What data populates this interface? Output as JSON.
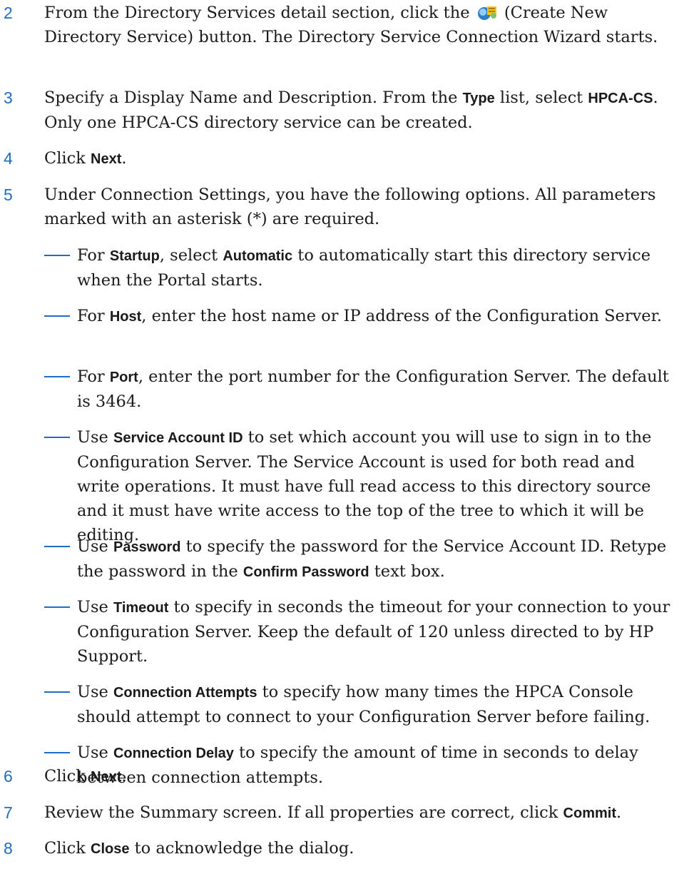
{
  "steps": {
    "s2": {
      "num": "2",
      "a": "From the Directory Services detail section, click the ",
      "icon_name": "create-directory-service-icon",
      "b": " (Create New Directory Service) button. The Directory Service Connection Wizard starts."
    },
    "s3": {
      "num": "3",
      "a": "Specify a Display Name and Description. From the ",
      "k1": "Type",
      "b": " list, select ",
      "k2": "HPCA-CS",
      "c": ". Only one HPCA-CS directory service can be created."
    },
    "s4": {
      "num": "4",
      "a": "Click ",
      "k1": "Next",
      "b": "."
    },
    "s5": {
      "num": "5",
      "a": "Under Connection Settings, you have the following options. All parameters marked with an asterisk (*) are required."
    },
    "s6": {
      "num": "6",
      "a": "Click ",
      "k1": "Next",
      "b": "."
    },
    "s7": {
      "num": "7",
      "a": "Review the Summary screen. If all properties are correct, click ",
      "k1": "Commit",
      "b": "."
    },
    "s8": {
      "num": "8",
      "a": "Click ",
      "k1": "Close",
      "b": " to acknowledge the dialog."
    }
  },
  "options": {
    "startup": {
      "a": "For ",
      "k1": "Startup",
      "b": ", select ",
      "k2": "Automatic",
      "c": " to automatically start this directory service when the Portal starts."
    },
    "host": {
      "a": "For ",
      "k1": "Host",
      "b": ", enter the host name or IP address of the Configuration Server."
    },
    "port": {
      "a": "For ",
      "k1": "Port",
      "b": ", enter the port number for the Configuration Server. The default is 3464."
    },
    "service_account": {
      "a": "Use ",
      "k1": "Service Account ID",
      "b": " to set which account you will use to sign in to the Configuration Server. The Service Account is used for both read and write operations. It must have full read access to this directory source and it must have write access to the top of the tree to which it will be editing."
    },
    "password": {
      "a": "Use ",
      "k1": "Password",
      "b": " to specify the password for the Service Account ID. Retype the password in the ",
      "k2": "Confirm Password",
      "c": " text box."
    },
    "timeout": {
      "a": "Use ",
      "k1": "Timeout",
      "b": " to specify in seconds the timeout for your connection to your Configuration Server. Keep the default of 120 unless directed to by HP Support."
    },
    "attempts": {
      "a": "Use ",
      "k1": "Connection Attempts",
      "b": " to specify how many times the HPCA Console should attempt to connect to your Configuration Server before failing."
    },
    "delay": {
      "a": "Use ",
      "k1": "Connection Delay",
      "b": " to specify the amount of time in seconds to delay between connection attempts."
    }
  },
  "colors": {
    "accent": "#1f6cc4",
    "text": "#1a1a1a"
  }
}
